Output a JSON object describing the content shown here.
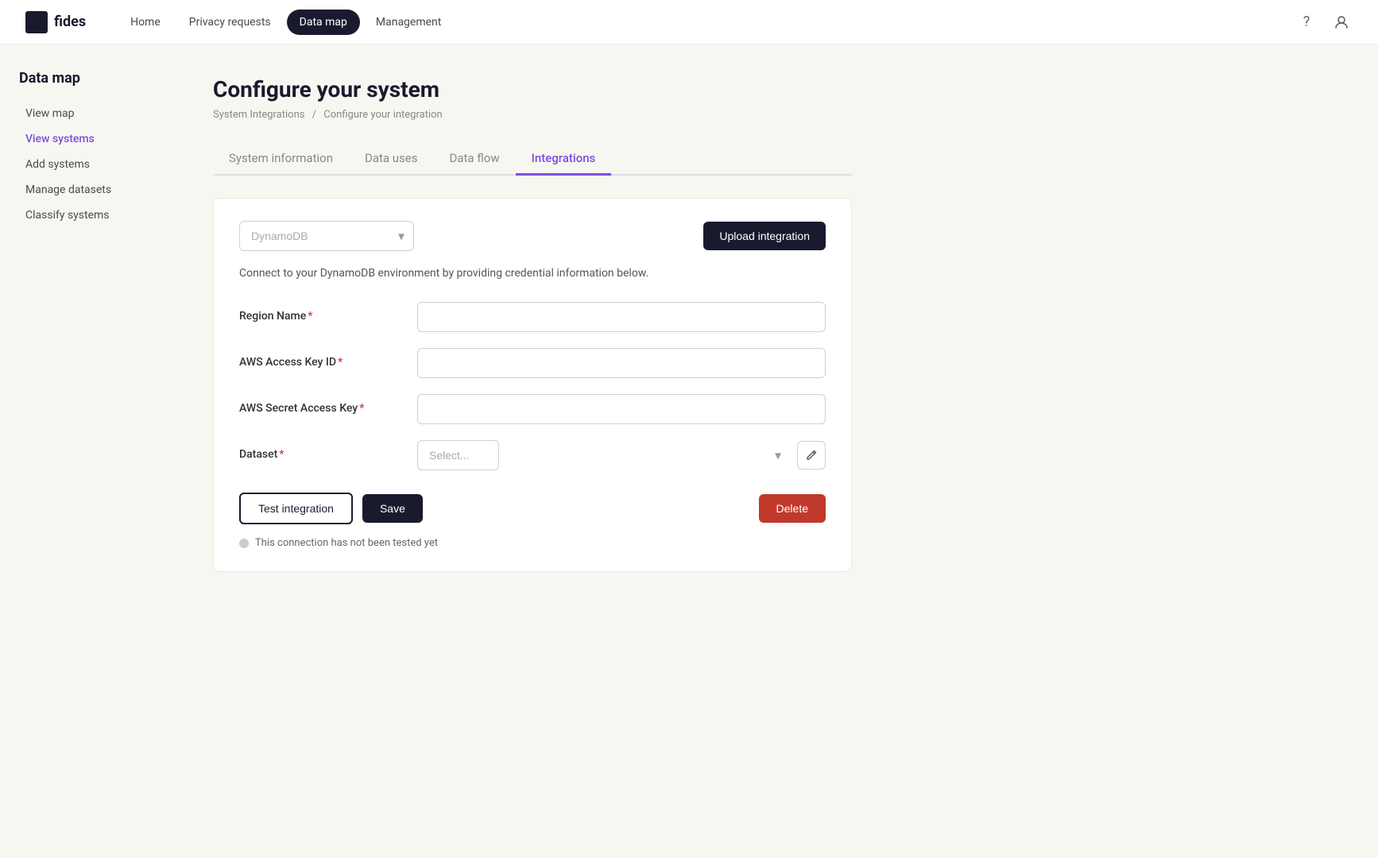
{
  "app": {
    "logo_text": "fides",
    "logo_icon_color": "#1a1a2e"
  },
  "top_nav": {
    "links": [
      {
        "id": "home",
        "label": "Home",
        "active": false
      },
      {
        "id": "privacy-requests",
        "label": "Privacy requests",
        "active": false
      },
      {
        "id": "data-map",
        "label": "Data map",
        "active": true
      },
      {
        "id": "management",
        "label": "Management",
        "active": false
      }
    ],
    "help_icon": "?",
    "user_icon": "👤"
  },
  "sidebar": {
    "title": "Data map",
    "items": [
      {
        "id": "view-map",
        "label": "View map",
        "active": false
      },
      {
        "id": "view-systems",
        "label": "View systems",
        "active": true
      },
      {
        "id": "add-systems",
        "label": "Add systems",
        "active": false
      },
      {
        "id": "manage-datasets",
        "label": "Manage datasets",
        "active": false
      },
      {
        "id": "classify-systems",
        "label": "Classify systems",
        "active": false
      }
    ]
  },
  "page": {
    "title": "Configure your system",
    "breadcrumb_root": "System Integrations",
    "breadcrumb_sep": "/",
    "breadcrumb_current": "Configure your integration"
  },
  "tabs": [
    {
      "id": "system-information",
      "label": "System information",
      "active": false
    },
    {
      "id": "data-uses",
      "label": "Data uses",
      "active": false
    },
    {
      "id": "data-flow",
      "label": "Data flow",
      "active": false
    },
    {
      "id": "integrations",
      "label": "Integrations",
      "active": true
    }
  ],
  "integration": {
    "dropdown_value": "DynamoDB",
    "dropdown_placeholder": "DynamoDB",
    "upload_btn_label": "Upload integration",
    "connect_desc": "Connect to your DynamoDB environment by providing credential information below.",
    "fields": [
      {
        "id": "region-name",
        "label": "Region Name",
        "required": true,
        "placeholder": "",
        "value": ""
      },
      {
        "id": "aws-access-key-id",
        "label": "AWS Access Key ID",
        "required": true,
        "placeholder": "",
        "value": ""
      },
      {
        "id": "aws-secret-access-key",
        "label": "AWS Secret Access Key",
        "required": true,
        "placeholder": "",
        "value": ""
      }
    ],
    "dataset_label": "Dataset",
    "dataset_required": true,
    "dataset_placeholder": "Select...",
    "edit_icon": "✎",
    "test_btn_label": "Test integration",
    "save_btn_label": "Save",
    "delete_btn_label": "Delete",
    "connection_status_text": "This connection has not been tested yet"
  }
}
